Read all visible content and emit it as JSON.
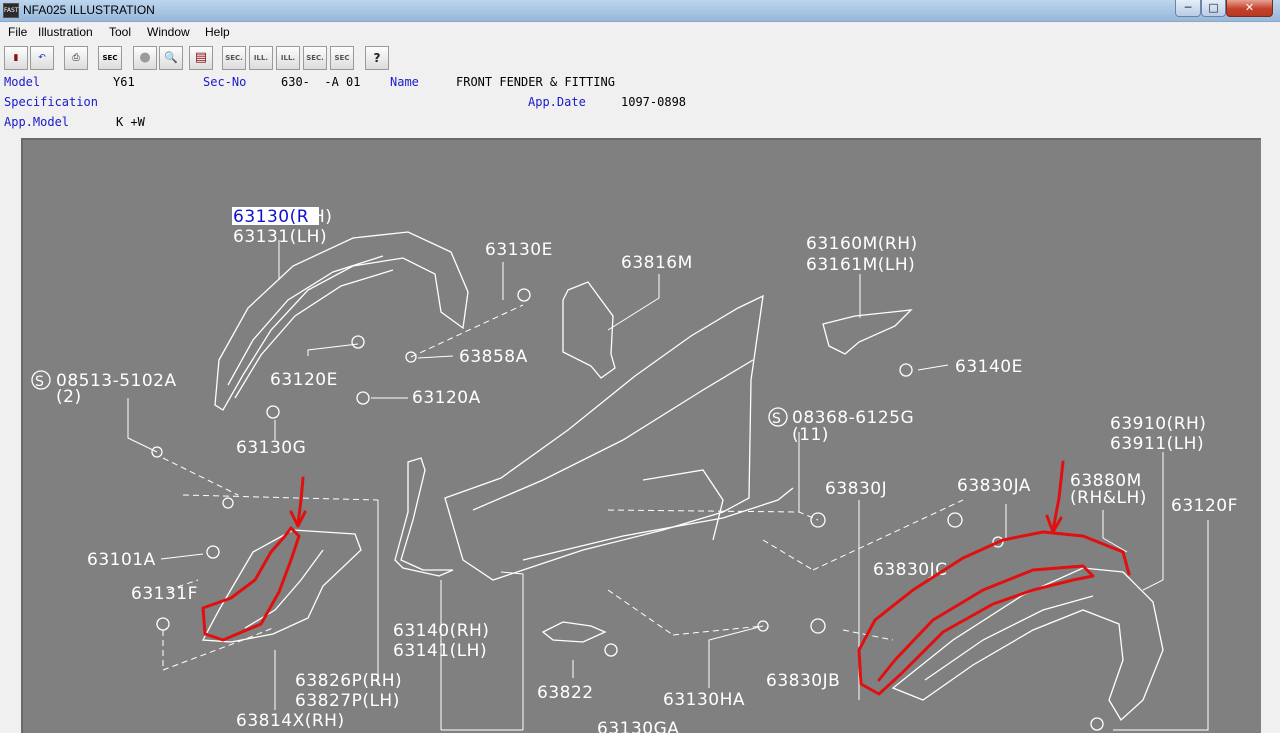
{
  "window": {
    "title": "NFA025  ILLUSTRATION",
    "app_icon": "FAST"
  },
  "window_controls": {
    "minimize": "─",
    "maximize": "□",
    "close": "✕"
  },
  "menu": [
    "File",
    "Illustration",
    "Tool",
    "Window",
    "Help"
  ],
  "toolbar": [
    {
      "name": "open-catalog-icon",
      "glyph": "▮"
    },
    {
      "name": "undo-icon",
      "glyph": "↶"
    },
    {
      "name": "print-icon",
      "glyph": "⎙"
    },
    {
      "name": "sec-button",
      "glyph": "SEC"
    },
    {
      "name": "circle-icon",
      "glyph": "●"
    },
    {
      "name": "zoom-icon",
      "glyph": "🔍"
    },
    {
      "name": "book-icon",
      "glyph": "▤"
    },
    {
      "name": "sec-prev-button",
      "glyph": "SEC."
    },
    {
      "name": "ill-prev-button",
      "glyph": "ILL."
    },
    {
      "name": "ill-next-button",
      "glyph": "ILL."
    },
    {
      "name": "sec-next-button",
      "glyph": "SEC."
    },
    {
      "name": "sec-query-button",
      "glyph": "SEC"
    },
    {
      "name": "help-icon",
      "glyph": "?"
    }
  ],
  "info": {
    "model_label": "Model",
    "model": "Y61",
    "secno_label": "Sec-No",
    "secno": "630-  -A 01",
    "name_label": "Name",
    "name": "FRONT FENDER & FITTING",
    "spec_label": "Specification",
    "appdate_label": "App.Date",
    "appdate": "1097-0898",
    "appmodel_label": "App.Model",
    "appmodel": "K +W"
  },
  "parts": {
    "p63130_hl": "63130(R",
    "p63130_rest": "H)",
    "p63131": "63131(LH)",
    "p63130E": "63130E",
    "p63816M": "63816M",
    "p63160M": "63160M(RH)",
    "p63161M": "63161M(LH)",
    "p63858A": "63858A",
    "p63140E": "63140E",
    "s08513": "08513-5102A",
    "s08513_qty": "(2)",
    "p63120E": "63120E",
    "p63120A": "63120A",
    "s08368": "08368-6125G",
    "s08368_qty": "(11)",
    "p63910": "63910(RH)",
    "p63911": "63911(LH)",
    "p63130G": "63130G",
    "p63830J": "63830J",
    "p63830JA": "63830JA",
    "p63880M": "63880M",
    "p63880M_side": "(RH&LH)",
    "p63120F": "63120F",
    "p63101A": "63101A",
    "p63830JC": "63830JC",
    "p63131F": "63131F",
    "p63140": "63140(RH)",
    "p63141": "63141(LH)",
    "p63826P": "63826P(RH)",
    "p63827P": "63827P(LH)",
    "p63822": "63822",
    "p63130HA": "63130HA",
    "p63830JB": "63830JB",
    "p63814X": "63814X(RH)",
    "p63130GA": "63130GA",
    "s_symbol": "S"
  }
}
